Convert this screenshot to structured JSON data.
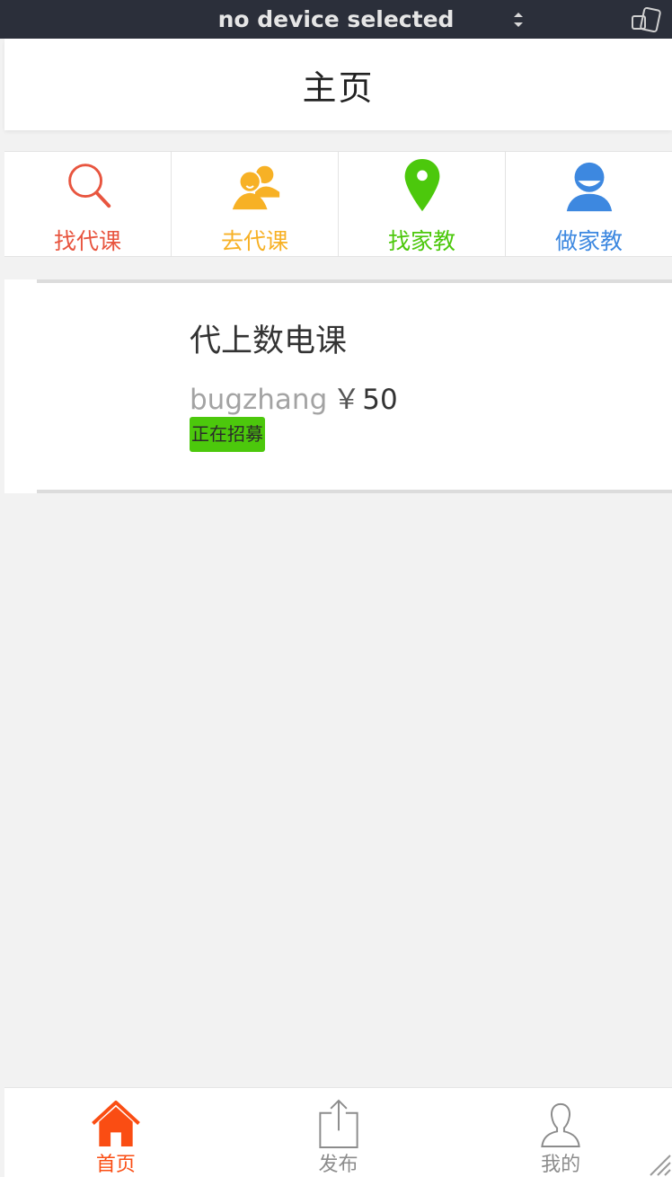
{
  "devbar": {
    "device_label": "no device selected"
  },
  "header": {
    "title": "主页"
  },
  "categories": [
    {
      "label": "找代课",
      "color": "#e8553f",
      "icon": "search-icon"
    },
    {
      "label": "去代课",
      "color": "#f7b125",
      "icon": "users-icon"
    },
    {
      "label": "找家教",
      "color": "#4cc80c",
      "icon": "location-pin-icon"
    },
    {
      "label": "做家教",
      "color": "#3d88e0",
      "icon": "user-icon"
    }
  ],
  "task": {
    "title": "代上数电课",
    "user": "bugzhang",
    "currency": "￥",
    "price": "50",
    "status": "正在招募",
    "status_color": "#4cc80c"
  },
  "tabbar": {
    "tabs": [
      {
        "label": "首页",
        "icon": "home-icon",
        "active": true
      },
      {
        "label": "发布",
        "icon": "share-icon",
        "active": false
      },
      {
        "label": "我的",
        "icon": "profile-icon",
        "active": false
      }
    ],
    "active_color": "#fa4d13",
    "inactive_color": "#8c8c8c"
  }
}
